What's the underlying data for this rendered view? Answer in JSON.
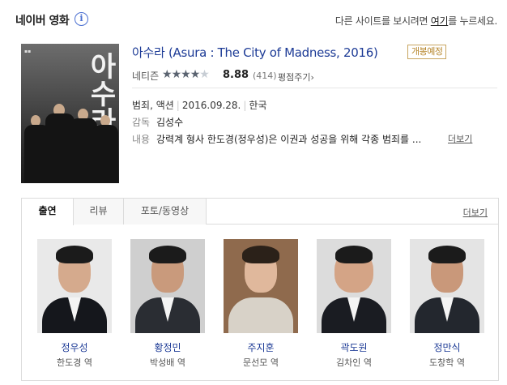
{
  "header": {
    "title": "네이버 영화",
    "notice_prefix": "다른 사이트를 보시려면 ",
    "notice_link": "여기",
    "notice_suffix": "를 누르세요."
  },
  "movie": {
    "poster_title": "아수라",
    "title": "아수라",
    "title_en": " (Asura : The City of Madness, 2016)",
    "badge": "개봉예정",
    "rating_label": "네티즌",
    "rating_stars": 4.44,
    "score": "8.88",
    "count": "(414)",
    "rate_link": "평점주기",
    "genre": "범죄, 액션",
    "release": "2016.09.28.",
    "country": "한국",
    "director_label": "감독",
    "director": "김성수",
    "summary_label": "내용",
    "summary": "강력계 형사 한도경(정우성)은 이권과 성공을 위해 각종 범죄를 ...",
    "more": "더보기"
  },
  "tabs": {
    "items": [
      {
        "label": "출연",
        "active": true
      },
      {
        "label": "리뷰",
        "active": false
      },
      {
        "label": "포토/동영상",
        "active": false
      }
    ],
    "more": "더보기"
  },
  "cast": [
    {
      "name": "정우성",
      "role": "한도경 역"
    },
    {
      "name": "황정민",
      "role": "박성배 역"
    },
    {
      "name": "주지훈",
      "role": "문선모 역"
    },
    {
      "name": "곽도원",
      "role": "김차인 역"
    },
    {
      "name": "정만식",
      "role": "도창학 역"
    }
  ],
  "colors": {
    "link_blue": "#1d3b96",
    "badge_gold": "#b6852a",
    "star": "#5a6370"
  }
}
